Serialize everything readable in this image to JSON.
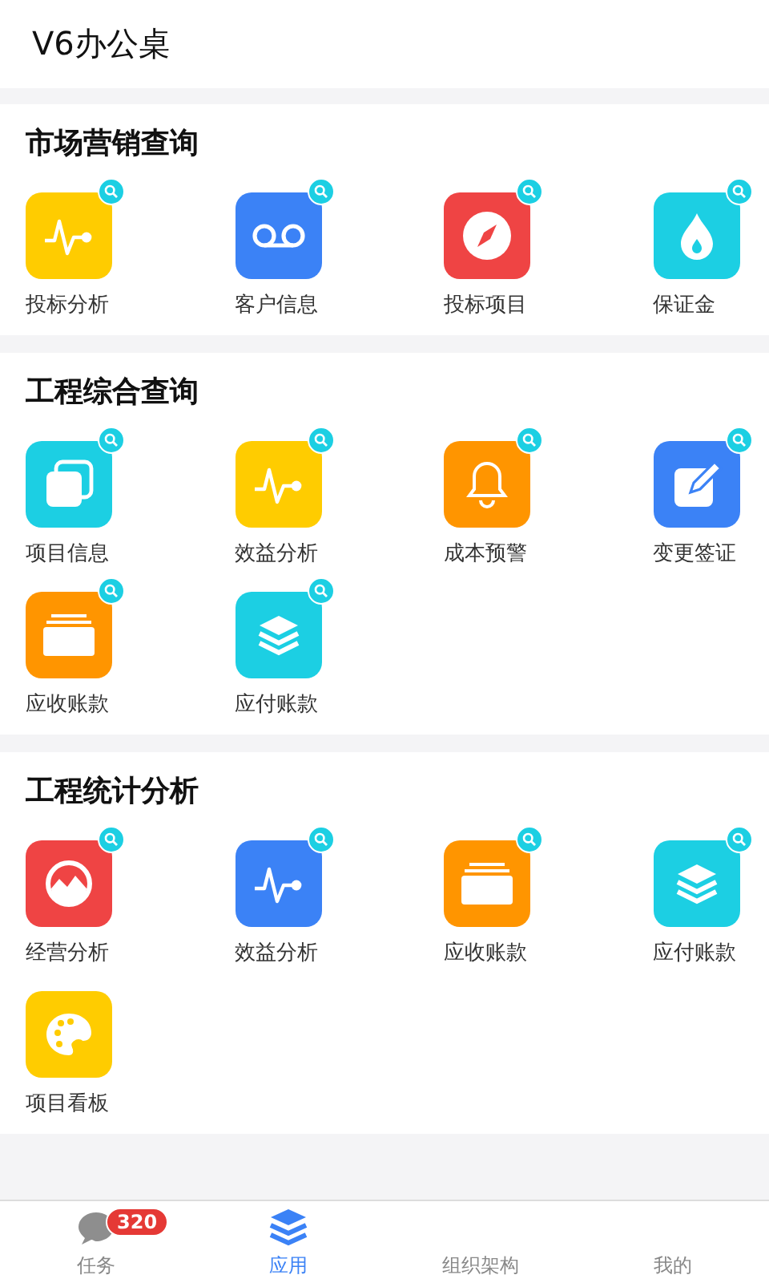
{
  "header": {
    "title": "V6办公桌"
  },
  "sections": [
    {
      "title": "市场营销查询",
      "items": [
        {
          "label": "投标分析",
          "kind": "pulse",
          "color": "#ffcc00",
          "searchable": true
        },
        {
          "label": "客户信息",
          "kind": "tape",
          "color": "#3b82f6",
          "searchable": true
        },
        {
          "label": "投标项目",
          "kind": "compass",
          "color": "#ef4444",
          "searchable": true
        },
        {
          "label": "保证金",
          "kind": "drop",
          "color": "#1ccfe3",
          "searchable": true
        }
      ]
    },
    {
      "title": "工程综合查询",
      "items": [
        {
          "label": "项目信息",
          "kind": "windows",
          "color": "#1ccfe3",
          "searchable": true
        },
        {
          "label": "效益分析",
          "kind": "pulse",
          "color": "#ffcc00",
          "searchable": true
        },
        {
          "label": "成本预警",
          "kind": "bell",
          "color": "#ff9500",
          "searchable": true
        },
        {
          "label": "变更签证",
          "kind": "edit",
          "color": "#3b82f6",
          "searchable": true
        },
        {
          "label": "应收账款",
          "kind": "folder",
          "color": "#ff9500",
          "searchable": true
        },
        {
          "label": "应付账款",
          "kind": "layers",
          "color": "#1ccfe3",
          "searchable": true
        }
      ]
    },
    {
      "title": "工程统计分析",
      "items": [
        {
          "label": "经营分析",
          "kind": "chart",
          "color": "#ef4444",
          "searchable": true
        },
        {
          "label": "效益分析",
          "kind": "pulse",
          "color": "#3b82f6",
          "searchable": true
        },
        {
          "label": "应收账款",
          "kind": "folder",
          "color": "#ff9500",
          "searchable": true
        },
        {
          "label": "应付账款",
          "kind": "layers",
          "color": "#1ccfe3",
          "searchable": true
        },
        {
          "label": "项目看板",
          "kind": "palette",
          "color": "#ffcc00",
          "searchable": false
        }
      ]
    }
  ],
  "tabs": [
    {
      "label": "任务",
      "kind": "chat",
      "badge": "320",
      "selected": false
    },
    {
      "label": "应用",
      "kind": "layers",
      "selected": true
    },
    {
      "label": "组织架构",
      "selected": false
    },
    {
      "label": "我的",
      "selected": false
    }
  ]
}
